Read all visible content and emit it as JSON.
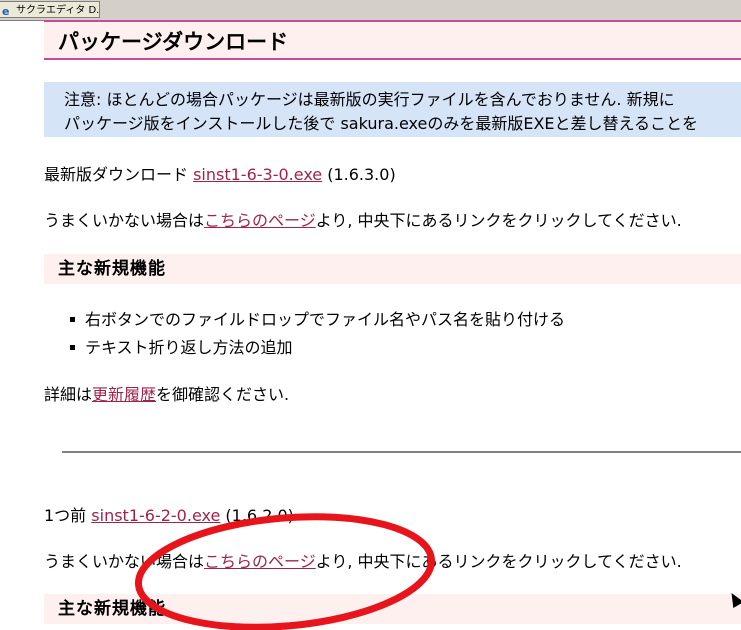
{
  "taskbar": {
    "tab_title": "サクラエディタ D..."
  },
  "page": {
    "title": "パッケージダウンロード",
    "notice": {
      "line1": "注意: ほとんどの場合パッケージは最新版の実行ファイルを含んでおりません. 新規に",
      "line2": "パッケージ版をインストールした後で sakura.exeのみを最新版EXEと差し替えることを"
    },
    "latest": {
      "prefix": "最新版ダウンロード ",
      "link": "sinst1-6-3-0.exe",
      "suffix": " (1.6.3.0)"
    },
    "help1": {
      "prefix": "うまくいかない場合は",
      "link": "こちらのページ",
      "suffix": "より, 中央下にあるリンクをクリックしてください."
    },
    "features_heading": "主な新規機能",
    "features": [
      "右ボタンでのファイルドロップでファイル名やパス名を貼り付ける",
      "テキスト折り返し方法の追加"
    ],
    "details": {
      "prefix": "詳細は",
      "link": "更新履歴",
      "suffix": "を御確認ください."
    },
    "previous": {
      "prefix": "1つ前 ",
      "link": "sinst1-6-2-0.exe",
      "suffix": " (1.6.2.0)"
    },
    "help2": {
      "prefix": "うまくいかない場合は",
      "link": "こちらのページ",
      "suffix": "より, 中央下にあるリンクをクリックしてください."
    },
    "features_heading2": "主な新規機能"
  },
  "colors": {
    "link": "#a0244a",
    "annotation": "#e8141c",
    "heading_border": "#c64b9a"
  }
}
